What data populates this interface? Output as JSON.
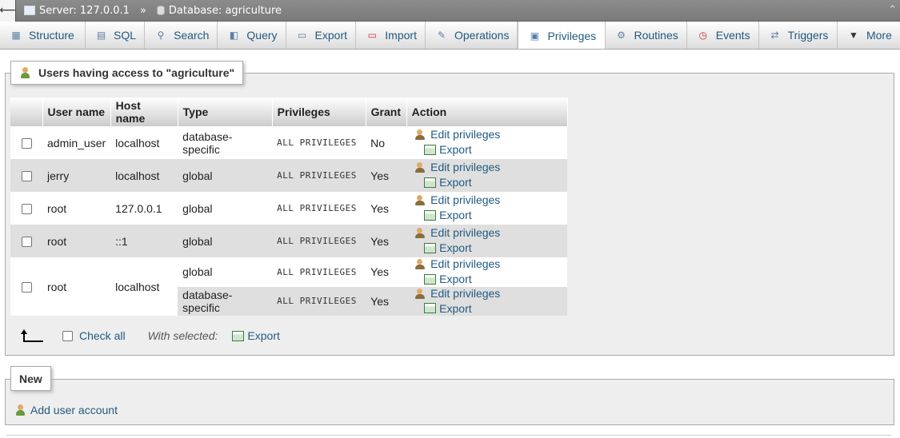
{
  "topbar": {
    "server_label": "Server: 127.0.0.1",
    "separator": "»",
    "database_label": "Database: agriculture"
  },
  "tabs": [
    {
      "label": "Structure",
      "icon": "structure-icon"
    },
    {
      "label": "SQL",
      "icon": "sql-icon"
    },
    {
      "label": "Search",
      "icon": "search-icon"
    },
    {
      "label": "Query",
      "icon": "query-icon"
    },
    {
      "label": "Export",
      "icon": "export-icon"
    },
    {
      "label": "Import",
      "icon": "import-icon"
    },
    {
      "label": "Operations",
      "icon": "wrench-icon"
    },
    {
      "label": "Privileges",
      "icon": "privileges-icon",
      "active": true
    },
    {
      "label": "Routines",
      "icon": "routines-icon"
    },
    {
      "label": "Events",
      "icon": "clock-icon"
    },
    {
      "label": "Triggers",
      "icon": "triggers-icon"
    },
    {
      "label": "More",
      "icon": "dropdown-icon"
    }
  ],
  "users_section": {
    "legend": "Users having access to \"agriculture\"",
    "columns": [
      "",
      "User name",
      "Host name",
      "Type",
      "Privileges",
      "Grant",
      "Action"
    ],
    "edit_label": "Edit privileges",
    "export_label": "Export",
    "rows": [
      {
        "user": "admin_user",
        "host": "localhost",
        "type": "database-specific",
        "privileges": "ALL PRIVILEGES",
        "grant": "No"
      },
      {
        "user": "jerry",
        "host": "localhost",
        "type": "global",
        "privileges": "ALL PRIVILEGES",
        "grant": "Yes"
      },
      {
        "user": "root",
        "host": "127.0.0.1",
        "type": "global",
        "privileges": "ALL PRIVILEGES",
        "grant": "Yes"
      },
      {
        "user": "root",
        "host": "::1",
        "type": "global",
        "privileges": "ALL PRIVILEGES",
        "grant": "Yes"
      },
      {
        "user": "root",
        "host": "localhost",
        "type": "global",
        "privileges": "ALL PRIVILEGES",
        "grant": "Yes"
      },
      {
        "user": "",
        "host": "",
        "type": "database-specific",
        "privileges": "ALL PRIVILEGES",
        "grant": "Yes"
      }
    ],
    "check_all": "Check all",
    "with_selected": "With selected:",
    "export_selected": "Export"
  },
  "new_section": {
    "legend": "New",
    "add_user": "Add user account"
  },
  "colors": {
    "link": "#235a81",
    "fieldset_bg": "#eeeeee",
    "topbar_bg": "#888888"
  }
}
